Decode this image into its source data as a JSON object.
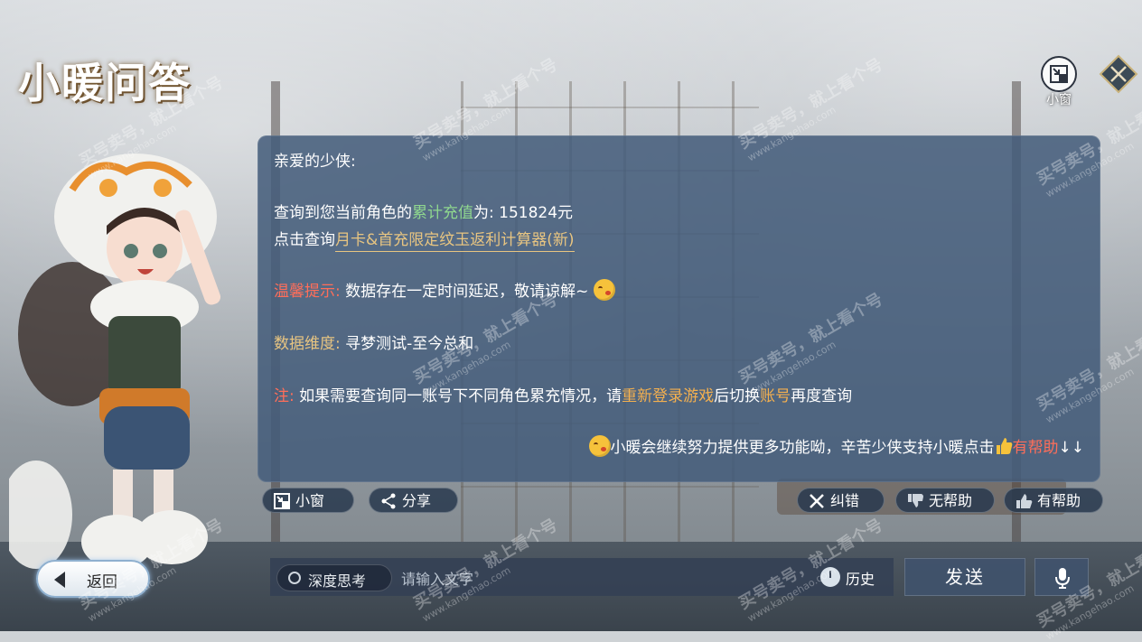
{
  "title": "小暖问答",
  "float_window": {
    "label": "小窗"
  },
  "message": {
    "greeting": "亲爱的少侠:",
    "query_prefix": "查询到您当前角色的",
    "query_highlight": "累计充值",
    "query_suffix": "为: 151824元",
    "link_prefix": "点击查询",
    "link_text": "月卡&首充限定纹玉返利计算器",
    "link_badge": "(新)",
    "tip_label": "温馨提示:",
    "tip_text": "数据存在一定时间延迟，敬请谅解~",
    "dimension_label": "数据维度:",
    "dimension_value": "寻梦测试-至今总和",
    "note_label": "注:",
    "note_text_1": "如果需要查询同一账号下不同角色累充情况，请",
    "note_highlight_1": "重新登录游戏",
    "note_text_2": "后切换",
    "note_highlight_2": "账号",
    "note_text_3": "再度查询",
    "footer_text": "小暖会继续努力提供更多功能呦，辛苦少侠支持小暖点击",
    "footer_highlight": "有帮助",
    "footer_arrows": "↓↓"
  },
  "actions": {
    "mini_window": "小窗",
    "share": "分享",
    "report_error": "纠错",
    "not_helpful": "无帮助",
    "helpful": "有帮助"
  },
  "bottom_bar": {
    "back": "返回",
    "deep_think": "深度思考",
    "input_placeholder": "请输入文字",
    "history": "历史",
    "send": "发送"
  },
  "watermark": {
    "text": "买号卖号，就上看个号",
    "url": "www.kangehao.com"
  },
  "colors": {
    "panel_bg": "#445c7a",
    "gold": "#e8c581",
    "green": "#8fd78e",
    "red": "#ff6e5a",
    "orange": "#f4b04f"
  }
}
